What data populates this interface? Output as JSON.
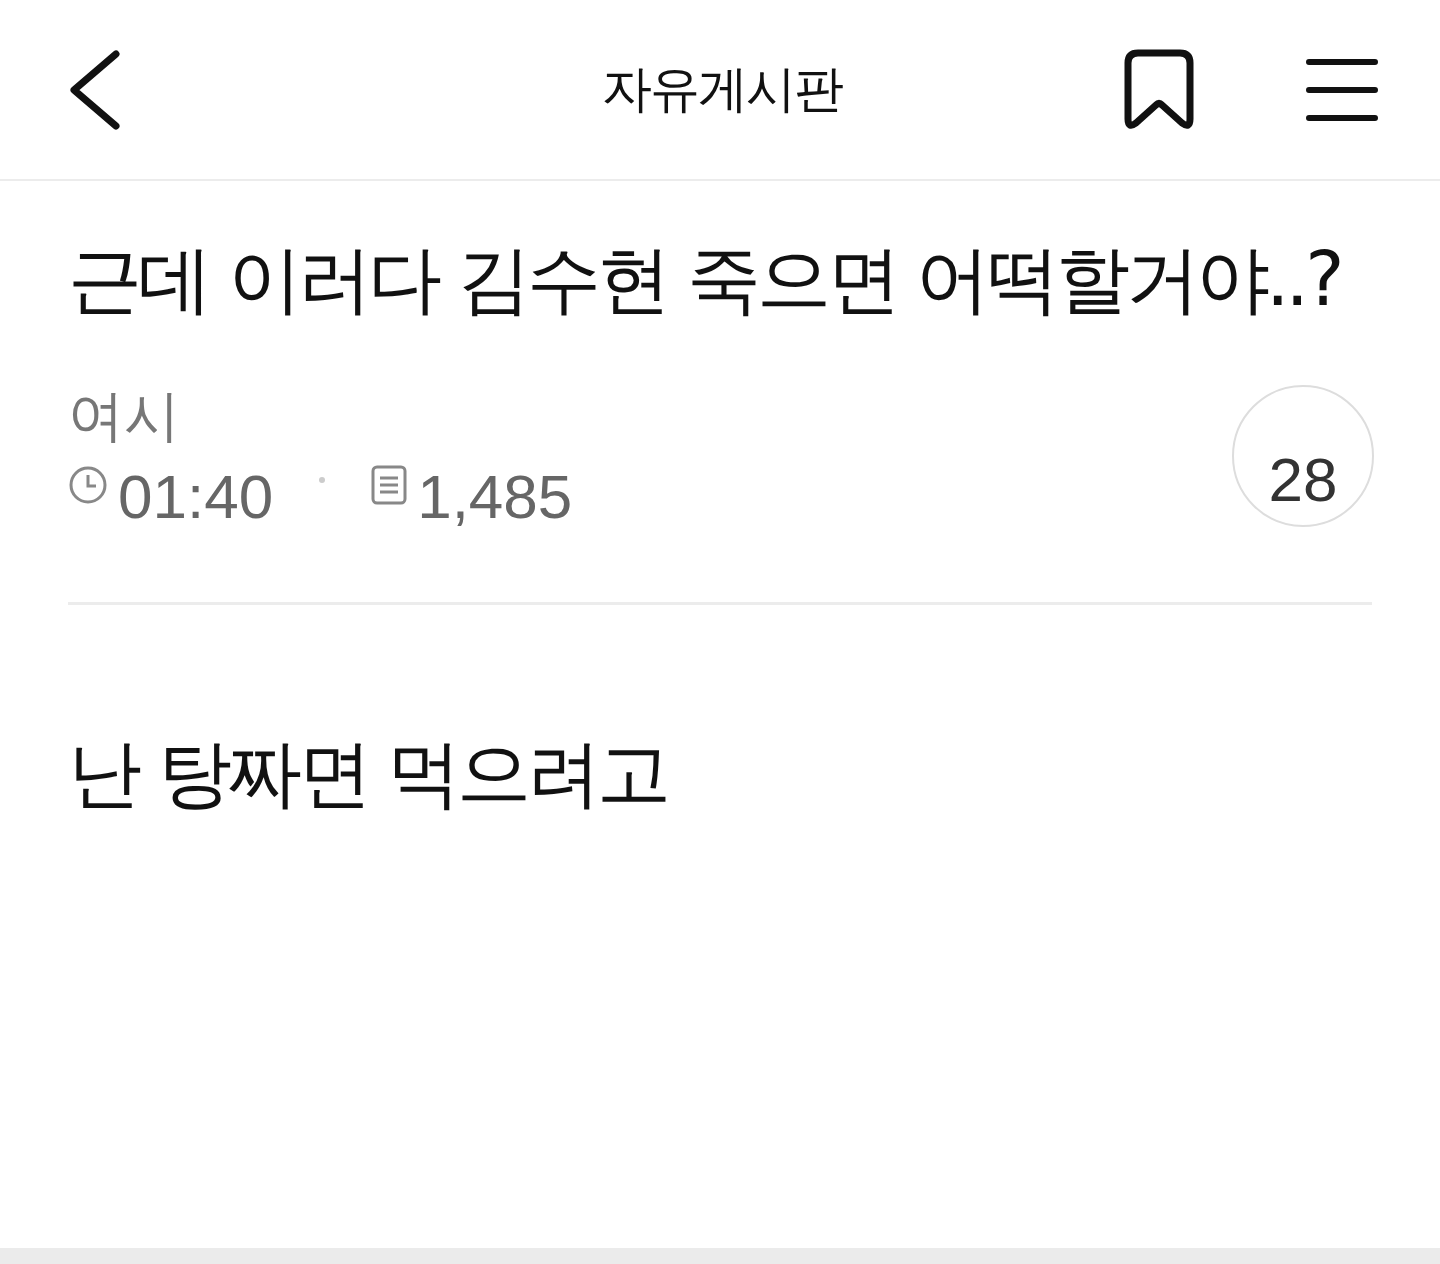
{
  "header": {
    "title": "자유게시판"
  },
  "post": {
    "title": "근데 이러다 김수현 죽으면 어떡할거야..?",
    "author": "여시",
    "time": "01:40",
    "views": "1,485",
    "comment_count": "28",
    "body": "난 탕짜면 먹으려고"
  }
}
